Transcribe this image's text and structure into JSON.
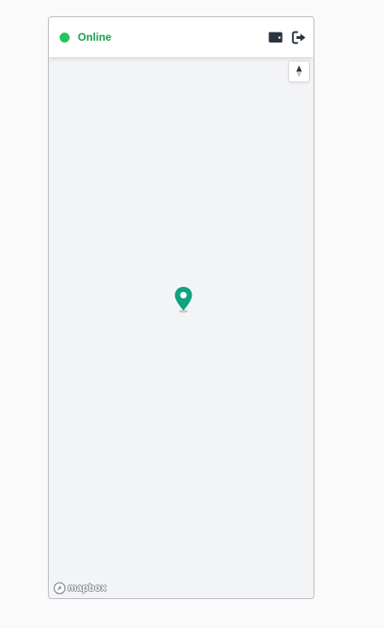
{
  "status": {
    "label": "Online",
    "color": "#22c55e"
  },
  "header": {
    "actions": [
      {
        "name": "wallet",
        "icon": "wallet-icon"
      },
      {
        "name": "logout",
        "icon": "sign-out-icon"
      }
    ]
  },
  "map": {
    "marker": {
      "icon": "map-pin-icon",
      "color": "#10a37f"
    },
    "compass": {
      "icon": "compass-north-icon"
    },
    "attribution": {
      "text": "mapbox",
      "icon": "mapbox-logo-icon"
    }
  }
}
